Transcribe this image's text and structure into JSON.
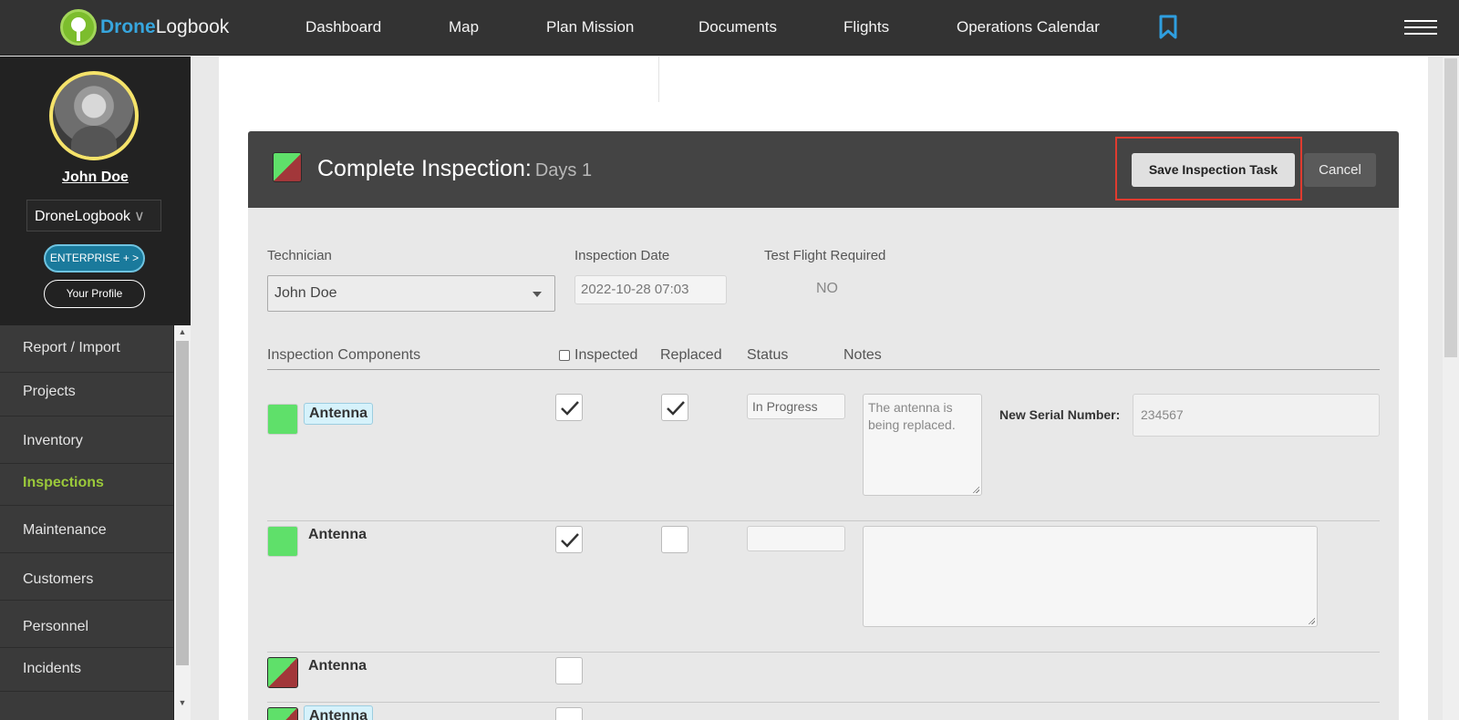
{
  "app": {
    "logo_part1": "Drone",
    "logo_part2": "Logbook",
    "nav": [
      "Dashboard",
      "Map",
      "Plan Mission",
      "Documents",
      "Flights",
      "Operations Calendar"
    ]
  },
  "sidebar": {
    "user_name": "John Doe",
    "org_select": "DroneLogbook",
    "org_chevron": "∨",
    "enterprise_label": "ENTERPRISE + >",
    "profile_label": "Your Profile",
    "menu": [
      "Report / Import",
      "Projects",
      "Inventory",
      "Inspections",
      "Maintenance",
      "Customers",
      "Personnel",
      "Incidents"
    ],
    "active_item": "Inspections"
  },
  "panel": {
    "title": "Complete Inspection:",
    "subtitle": "Days 1",
    "save_label": "Save Inspection Task",
    "cancel_label": "Cancel",
    "status_icon": "status-square-icon"
  },
  "form": {
    "technician_label": "Technician",
    "technician_value": "John Doe",
    "date_label": "Inspection Date",
    "date_value": "2022-10-28 07:03",
    "test_flight_label": "Test Flight Required",
    "test_flight_value": "NO"
  },
  "table": {
    "headers": {
      "components": "Inspection Components",
      "inspected": "Inspected",
      "replaced": "Replaced",
      "status": "Status",
      "notes": "Notes"
    },
    "rows": [
      {
        "name": "Antenna",
        "inspected": true,
        "replaced": true,
        "status": "In Progress",
        "notes": "The antenna is being replaced.",
        "serial_label": "New Serial Number:",
        "serial_value": "234567"
      },
      {
        "name": "Antenna",
        "inspected": true,
        "replaced": false,
        "status": "",
        "notes": ""
      },
      {
        "name": "Antenna",
        "inspected": false
      },
      {
        "name": "Antenna",
        "inspected": false
      }
    ]
  },
  "colors": {
    "nav_bg": "#333333",
    "accent_blue": "#37a6de",
    "active_green": "#9bc93a",
    "status_green": "#5fe06a",
    "status_red": "#a2373a",
    "highlight_red": "#e03b2f"
  }
}
